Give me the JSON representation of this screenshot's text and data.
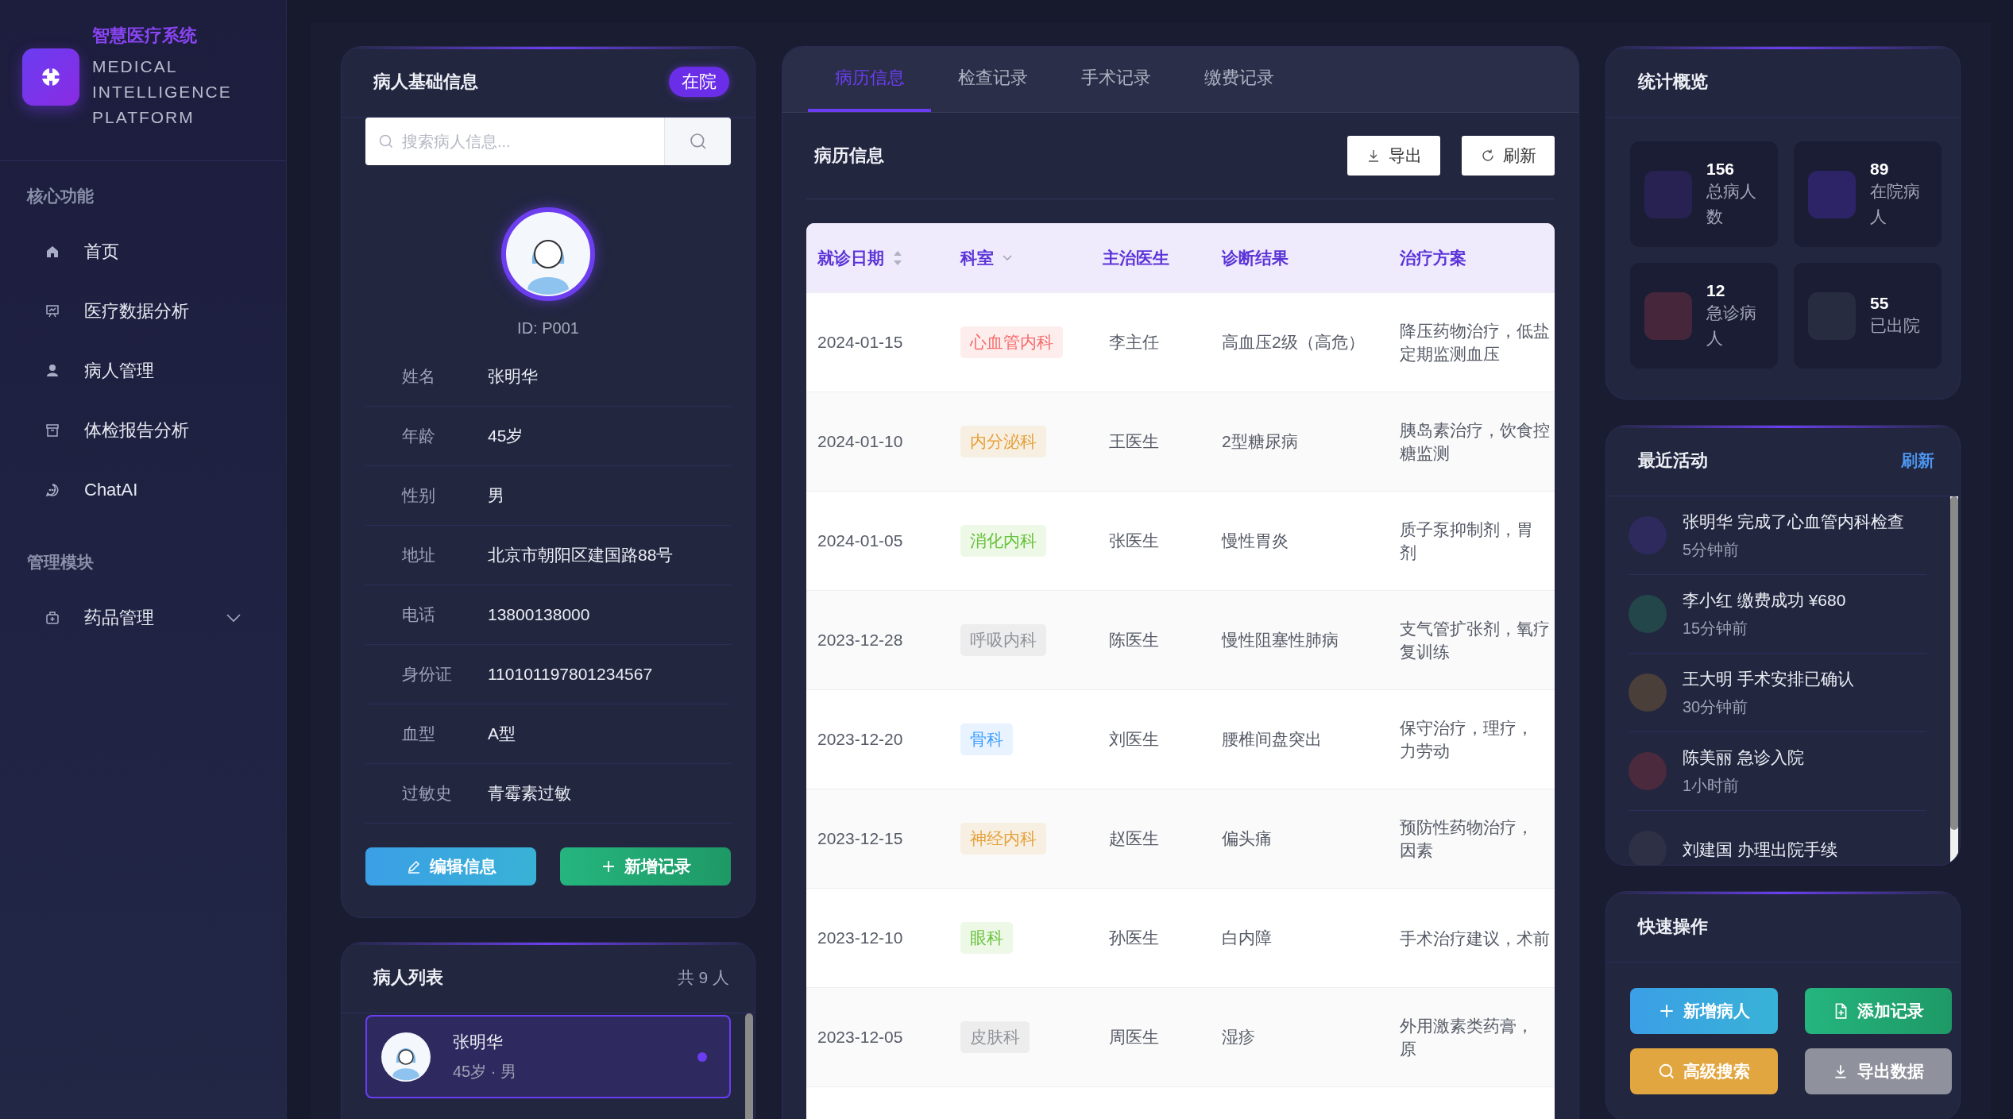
{
  "sidebar": {
    "brand_title": "智慧医疗系统",
    "brand_subtitle": [
      "MEDICAL",
      "INTELLIGENCE",
      "PLATFORM"
    ],
    "sections": [
      {
        "title": "核心功能",
        "items": [
          {
            "label": "首页"
          },
          {
            "label": "医疗数据分析"
          },
          {
            "label": "病人管理"
          },
          {
            "label": "体检报告分析"
          },
          {
            "label": "ChatAI"
          }
        ]
      },
      {
        "title": "管理模块",
        "items": [
          {
            "label": "药品管理",
            "expanded": false
          }
        ]
      }
    ]
  },
  "patient_card": {
    "title": "病人基础信息",
    "status": "在院",
    "search": {
      "placeholder": "搜索病人信息..."
    },
    "id": "ID: P001",
    "fields": [
      {
        "label": "姓名",
        "value": "张明华"
      },
      {
        "label": "年龄",
        "value": "45岁"
      },
      {
        "label": "性别",
        "value": "男"
      },
      {
        "label": "地址",
        "value": "北京市朝阳区建国路88号"
      },
      {
        "label": "电话",
        "value": "13800138000"
      },
      {
        "label": "身份证",
        "value": "110101197801234567"
      },
      {
        "label": "血型",
        "value": "A型"
      },
      {
        "label": "过敏史",
        "value": "青霉素过敏"
      }
    ],
    "buttons": [
      {
        "label": "编辑信息",
        "kind": "edit"
      },
      {
        "label": "新增记录",
        "kind": "add"
      }
    ]
  },
  "patient_list": {
    "title": "病人列表",
    "count": "共 9 人",
    "items": [
      {
        "name": "张明华",
        "meta": "45岁 · 男",
        "selected": true
      }
    ]
  },
  "records": {
    "tabs": [
      {
        "label": "病历信息",
        "selected": true
      },
      {
        "label": "检查记录",
        "selected": false
      },
      {
        "label": "手术记录",
        "selected": false
      },
      {
        "label": "缴费记录",
        "selected": false
      }
    ],
    "title": "病历信息",
    "actions": [
      {
        "label": "导出",
        "kind": "export"
      },
      {
        "label": "刷新",
        "kind": "refresh"
      }
    ],
    "columns": [
      {
        "label": "就诊日期",
        "kind": "sort"
      },
      {
        "label": "科室",
        "kind": "filter"
      },
      {
        "label": "主治医生",
        "kind": "plain"
      },
      {
        "label": "诊断结果",
        "kind": "plain"
      },
      {
        "label": "治疗方案",
        "kind": "plain"
      }
    ],
    "rows": [
      {
        "date": "2024-01-15",
        "department": "心血管内科",
        "color": "#f56c6c",
        "doctor": "李主任",
        "diagnosis": "高血压2级（高危）",
        "treatment": [
          "降压药物治疗，低盐",
          "定期监测血压"
        ]
      },
      {
        "date": "2024-01-10",
        "department": "内分泌科",
        "color": "#e6a23c",
        "doctor": "王医生",
        "diagnosis": "2型糖尿病",
        "treatment": [
          "胰岛素治疗，饮食控",
          "糖监测"
        ]
      },
      {
        "date": "2024-01-05",
        "department": "消化内科",
        "color": "#67c23a",
        "doctor": "张医生",
        "diagnosis": "慢性胃炎",
        "treatment": [
          "质子泵抑制剂，胃",
          "剂"
        ]
      },
      {
        "date": "2023-12-28",
        "department": "呼吸内科",
        "color": "#909399",
        "doctor": "陈医生",
        "diagnosis": "慢性阻塞性肺病",
        "treatment": [
          "支气管扩张剂，氧疗",
          "复训练"
        ]
      },
      {
        "date": "2023-12-20",
        "department": "骨科",
        "color": "#409eff",
        "doctor": "刘医生",
        "diagnosis": "腰椎间盘突出",
        "treatment": [
          "保守治疗，理疗，",
          "力劳动"
        ]
      },
      {
        "date": "2023-12-15",
        "department": "神经内科",
        "color": "#e6a23c",
        "doctor": "赵医生",
        "diagnosis": "偏头痛",
        "treatment": [
          "预防性药物治疗，",
          "因素"
        ]
      },
      {
        "date": "2023-12-10",
        "department": "眼科",
        "color": "#67c23a",
        "doctor": "孙医生",
        "diagnosis": "白内障",
        "treatment": [
          "手术治疗建议，术前"
        ]
      },
      {
        "date": "2023-12-05",
        "department": "皮肤科",
        "color": "#909399",
        "doctor": "周医生",
        "diagnosis": "湿疹",
        "treatment": [
          "外用激素类药膏，",
          "原"
        ]
      }
    ]
  },
  "stats": {
    "title": "统计概览",
    "items": [
      {
        "value": "156",
        "label": "总病人数",
        "color": "#272252"
      },
      {
        "value": "89",
        "label": "在院病人",
        "color": "#2c2466"
      },
      {
        "value": "12",
        "label": "急诊病人",
        "color": "#45263a"
      },
      {
        "value": "55",
        "label": "已出院",
        "color": "#282c40"
      }
    ]
  },
  "activity": {
    "title": "最近活动",
    "action": "刷新",
    "items": [
      {
        "text": "张明华 完成了心血管内科检查",
        "time": "5分钟前",
        "color": "#2f2a5e"
      },
      {
        "text": "李小红 缴费成功 ¥680",
        "time": "15分钟前",
        "color": "#23464a"
      },
      {
        "text": "王大明 手术安排已确认",
        "time": "30分钟前",
        "color": "#4b3f3a"
      },
      {
        "text": "陈美丽 急诊入院",
        "time": "1小时前",
        "color": "#4b2a3d"
      },
      {
        "text": "刘建国 办理出院手续",
        "color": "#2e3045"
      }
    ]
  },
  "quick_actions": {
    "title": "快速操作",
    "buttons": [
      {
        "label": "新增病人",
        "kind": "add"
      },
      {
        "label": "添加记录",
        "kind": "record"
      },
      {
        "label": "高级搜索",
        "kind": "search"
      },
      {
        "label": "导出数据",
        "kind": "export"
      }
    ]
  }
}
